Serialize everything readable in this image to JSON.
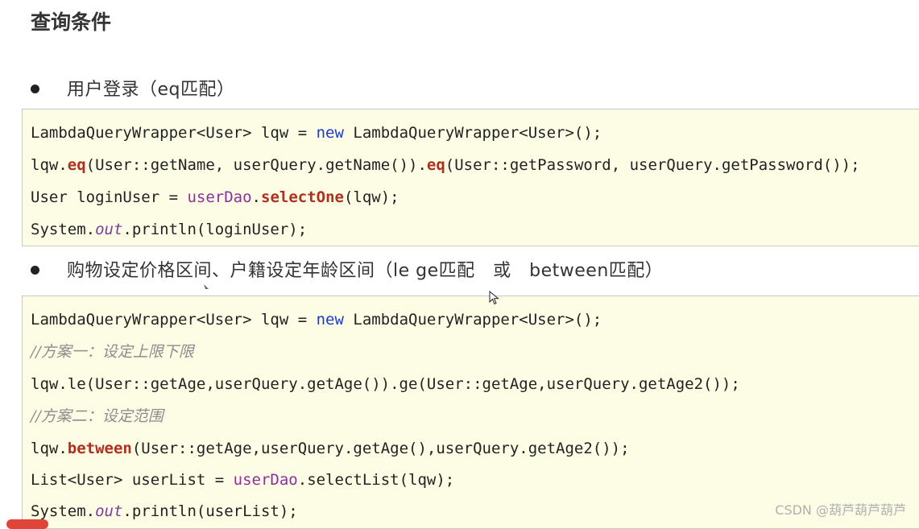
{
  "page": {
    "title": "查询条件"
  },
  "sections": [
    {
      "bullet": "用户登录（eq匹配）",
      "code": [
        [
          {
            "t": "LambdaQueryWrapper<User> lqw = "
          },
          {
            "t": "new",
            "c": "kw"
          },
          {
            "t": " LambdaQueryWrapper<User>();"
          }
        ],
        [
          {
            "t": "lqw."
          },
          {
            "t": "eq",
            "c": "meth"
          },
          {
            "t": "(User::getName, userQuery.getName())."
          },
          {
            "t": "eq",
            "c": "meth"
          },
          {
            "t": "(User::getPassword, userQuery.getPassword());"
          }
        ],
        [
          {
            "t": "User loginUser = "
          },
          {
            "t": "userDao",
            "c": "field"
          },
          {
            "t": "."
          },
          {
            "t": "selectOne",
            "c": "meth"
          },
          {
            "t": "(lqw);"
          }
        ],
        [
          {
            "t": "System."
          },
          {
            "t": "out",
            "c": "static"
          },
          {
            "t": ".println(loginUser);"
          }
        ]
      ]
    },
    {
      "bullet": "购物设定价格区间、户籍设定年龄区间（le ge匹配　或　between匹配）",
      "code": [
        [
          {
            "t": "LambdaQueryWrapper<User> lqw = "
          },
          {
            "t": "new",
            "c": "kw"
          },
          {
            "t": " LambdaQueryWrapper<User>();"
          }
        ],
        [
          {
            "t": "//方案一：设定上限下限",
            "c": "comment"
          }
        ],
        [
          {
            "t": "lqw.le(User::getAge,userQuery.getAge()).ge(User::getAge,userQuery.getAge2());"
          }
        ],
        [
          {
            "t": "//方案二：设定范围",
            "c": "comment"
          }
        ],
        [
          {
            "t": "lqw."
          },
          {
            "t": "between",
            "c": "meth"
          },
          {
            "t": "(User::getAge,userQuery.getAge(),userQuery.getAge2());"
          }
        ],
        [
          {
            "t": "List<User> userList = "
          },
          {
            "t": "userDao",
            "c": "field"
          },
          {
            "t": ".selectList(lqw);"
          }
        ],
        [
          {
            "t": "System."
          },
          {
            "t": "out",
            "c": "static"
          },
          {
            "t": ".println(userList);"
          }
        ]
      ]
    }
  ],
  "watermark": "CSDN @葫芦葫芦葫芦",
  "icons": {
    "cursor": "mouse-pointer-icon",
    "bullet": "bullet-dot-icon"
  },
  "colors": {
    "code_bg": "#fdfde6",
    "keyword": "#1a3bd0",
    "method": "#b03020",
    "field": "#8e2fa0",
    "comment": "#8c8c8c"
  }
}
